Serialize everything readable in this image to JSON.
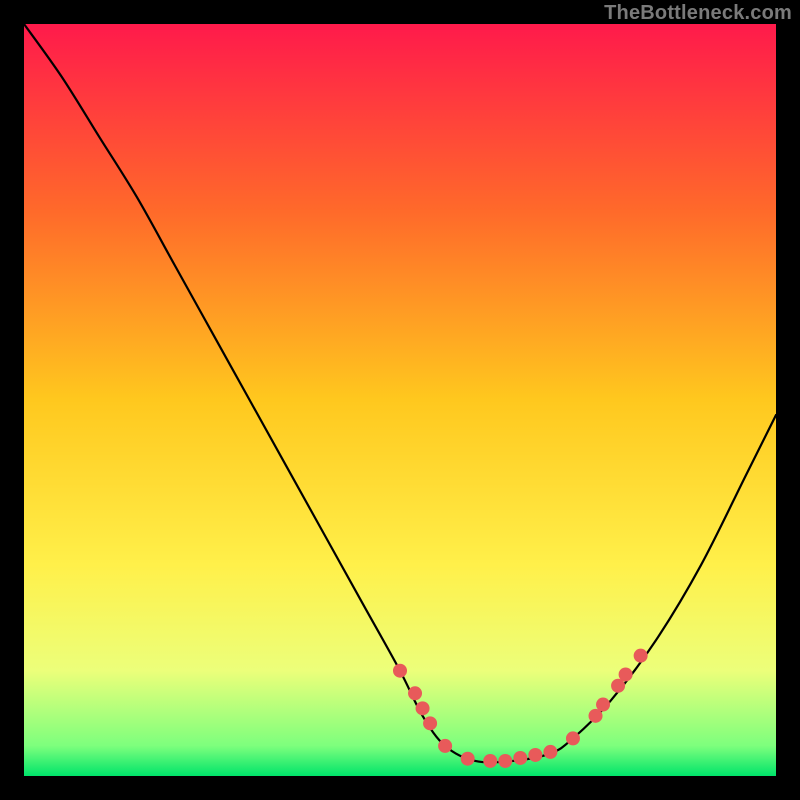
{
  "attribution": "TheBottleneck.com",
  "chart_data": {
    "type": "line",
    "title": "",
    "xlabel": "",
    "ylabel": "",
    "xlim": [
      0,
      100
    ],
    "ylim": [
      0,
      100
    ],
    "gradient_stops": [
      {
        "offset": 0,
        "color": "#ff1a4b"
      },
      {
        "offset": 25,
        "color": "#ff6a2a"
      },
      {
        "offset": 50,
        "color": "#ffc81e"
      },
      {
        "offset": 72,
        "color": "#fff04a"
      },
      {
        "offset": 86,
        "color": "#ecff7a"
      },
      {
        "offset": 96,
        "color": "#7dff7d"
      },
      {
        "offset": 100,
        "color": "#00e46a"
      }
    ],
    "series": [
      {
        "name": "bottleneck-curve",
        "x": [
          0,
          5,
          10,
          15,
          20,
          25,
          30,
          35,
          40,
          45,
          50,
          53,
          56,
          60,
          65,
          70,
          73,
          78,
          84,
          90,
          96,
          100
        ],
        "y": [
          100,
          93,
          85,
          77,
          68,
          59,
          50,
          41,
          32,
          23,
          14,
          8,
          4,
          2,
          2,
          3,
          5,
          10,
          18,
          28,
          40,
          48
        ]
      }
    ],
    "markers": {
      "name": "highlight-points",
      "color": "#e85a5a",
      "radius": 7,
      "points": [
        {
          "x": 50,
          "y": 14
        },
        {
          "x": 52,
          "y": 11
        },
        {
          "x": 53,
          "y": 9
        },
        {
          "x": 54,
          "y": 7
        },
        {
          "x": 56,
          "y": 4
        },
        {
          "x": 59,
          "y": 2.3
        },
        {
          "x": 62,
          "y": 2
        },
        {
          "x": 64,
          "y": 2
        },
        {
          "x": 66,
          "y": 2.4
        },
        {
          "x": 68,
          "y": 2.8
        },
        {
          "x": 70,
          "y": 3.2
        },
        {
          "x": 73,
          "y": 5
        },
        {
          "x": 76,
          "y": 8
        },
        {
          "x": 77,
          "y": 9.5
        },
        {
          "x": 79,
          "y": 12
        },
        {
          "x": 80,
          "y": 13.5
        },
        {
          "x": 82,
          "y": 16
        }
      ]
    }
  }
}
